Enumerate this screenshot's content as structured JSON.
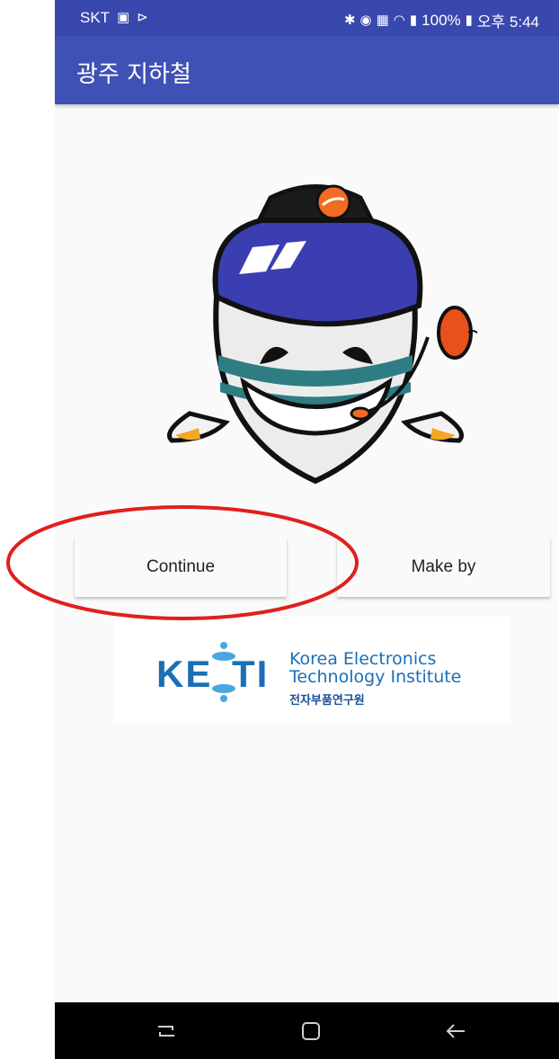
{
  "status_bar": {
    "carrier": "SKT",
    "battery": "100%",
    "time": "오후 5:44"
  },
  "app_bar": {
    "title": "광주 지하철"
  },
  "buttons": {
    "continue_label": "Continue",
    "make_by_label": "Make by"
  },
  "logo": {
    "mark": "KETI",
    "line1": "Korea Electronics",
    "line2": "Technology Institute",
    "line3": "전자부품연구원"
  },
  "nav_bar": {
    "icons": [
      "recent-apps-icon",
      "home-icon",
      "back-icon"
    ]
  },
  "colors": {
    "app_bar": "#3f51b5",
    "status_bar": "#3848ad",
    "highlight": "#e0201c",
    "keti_blue": "#1a6fb6",
    "mascot_helmet": "#3a3eb0"
  }
}
